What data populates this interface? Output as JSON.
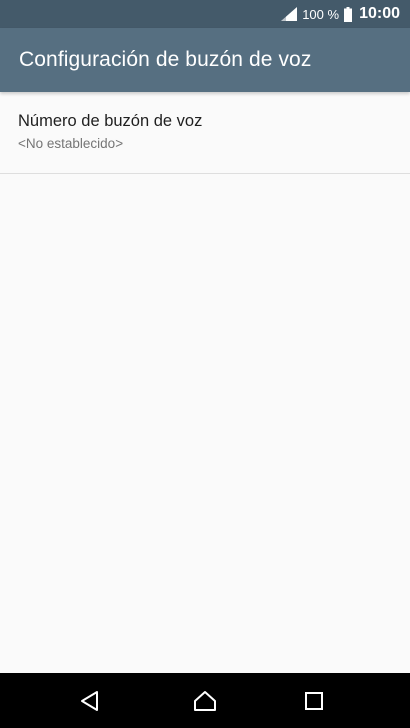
{
  "status_bar": {
    "battery_percent": "100 %",
    "time": "10:00",
    "icons": [
      "signal-icon",
      "battery-icon"
    ]
  },
  "app_bar": {
    "title": "Configuración de buzón de voz"
  },
  "preferences": [
    {
      "title": "Número de buzón de voz",
      "summary": "<No establecido>"
    }
  ],
  "nav_bar": {
    "icons": [
      "back-icon",
      "home-icon",
      "recents-icon"
    ]
  },
  "colors": {
    "status_bar": "#445a6a",
    "app_bar": "#566f81",
    "background": "#fafafa",
    "nav_bar": "#000000"
  }
}
